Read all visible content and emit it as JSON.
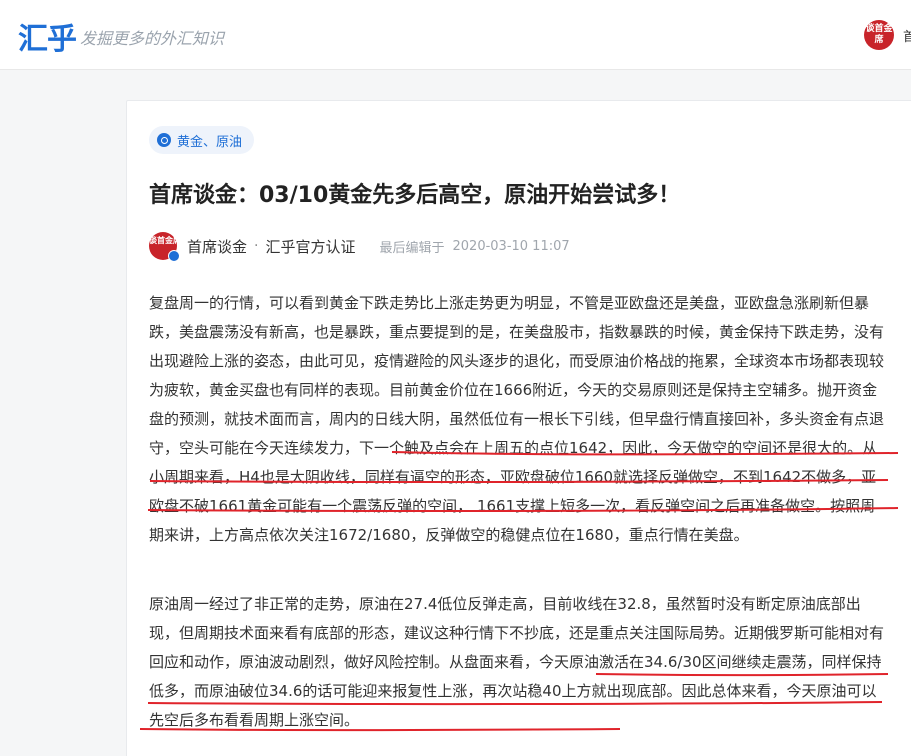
{
  "header": {
    "logo": "汇乎",
    "slogan": "发掘更多的外汇知识",
    "avatar_text": "谈首金席",
    "user_label": "首"
  },
  "article": {
    "tag": "黄金、原油",
    "title": "首席谈金：03/10黄金先多后高空，原油开始尝试多！",
    "author_avatar_text": "谈首金席",
    "author_name": "首席谈金",
    "separator": "·",
    "verification": "汇乎官方认证",
    "edit_label": "最后编辑于",
    "edit_time": "2020-03-10 11:07",
    "paragraphs": [
      "复盘周一的行情，可以看到黄金下跌走势比上涨走势更为明显，不管是亚欧盘还是美盘，亚欧盘急涨刷新但暴跌，美盘震荡没有新高，也是暴跌，重点要提到的是，在美盘股市，指数暴跌的时候，黄金保持下跌走势，没有出现避险上涨的姿态，由此可见，疫情避险的风头逐步的退化，而受原油价格战的拖累，全球资本市场都表现较为疲软，黄金买盘也有同样的表现。目前黄金价位在1666附近，今天的交易原则还是保持主空辅多。抛开资金盘的预测，就技术面而言，周内的日线大阴，虽然低位有一根长下引线，但早盘行情直接回补，多头资金有点退守，空头可能在今天连续发力，下一个触及点会在上周五的点位1642，因此，今天做空的空间还是很大的。从小周期来看，H4也是大阴收线，同样有逼空的形态，亚欧盘破位1660就选择反弹做空，不到1642不做多，亚欧盘不破1661黄金可能有一个震荡反弹的空间， 1661支撑上短多一次，看反弹空间之后再准备做空。按照周期来讲，上方高点依次关注1672/1680，反弹做空的稳健点位在1680，重点行情在美盘。",
      "原油周一经过了非正常的走势，原油在27.4低位反弹走高，目前收线在32.8，虽然暂时没有断定原油底部出现，但周期技术面来看有底部的形态，建议这种行情下不抄底，还是重点关注国际局势。近期俄罗斯可能相对有回应和动作，原油波动剧烈，做好风险控制。从盘面来看，今天原油激活在34.6/30区间继续走震荡，同样保持低多，而原油破位34.6的话可能迎来报复性上涨，再次站稳40上方就出现底部。因此总体来看，今天原油可以先空后多布看看周期上涨空间。"
    ]
  },
  "colors": {
    "brand_blue": "#1f6fd6",
    "annotation_red": "#e0242b",
    "avatar_red": "#c8242a"
  }
}
